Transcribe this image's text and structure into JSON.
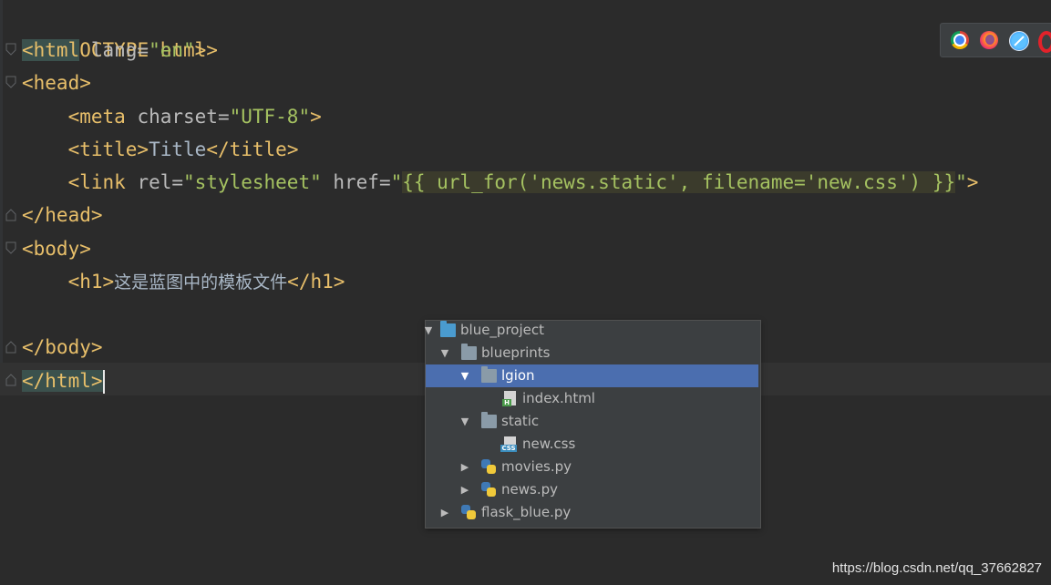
{
  "editor": {
    "lines": [
      {
        "open": "<!DOCTYPE html>"
      },
      {
        "tag_open": "<html",
        "attr": " lang=",
        "val": "\"en\"",
        "close": ">"
      },
      {
        "tag": "<head>"
      },
      {
        "indent": "    ",
        "tag_open": "<meta",
        "attr": " charset=",
        "val": "\"UTF-8\"",
        "close": ">"
      },
      {
        "indent": "    ",
        "tag_open": "<title>",
        "text": "Title",
        "close": "</title>"
      },
      {
        "indent": "    ",
        "tag_open": "<link",
        "attr1": " rel=",
        "val1": "\"stylesheet\"",
        "attr2": " href=",
        "q_open": "\"",
        "tpl": "{{ url_for('news.static', filename='new.css') }}",
        "q_close": "\"",
        "close": ">"
      },
      {
        "tag": "</head>"
      },
      {
        "tag": "<body>"
      },
      {
        "indent": "    ",
        "tag_open": "<h1>",
        "text": "这是蓝图中的模板文件",
        "close": "</h1>"
      },
      {
        "tag": ""
      },
      {
        "tag": "</body>"
      },
      {
        "tag": "</html>"
      }
    ]
  },
  "browser_icons": [
    "chrome-icon",
    "firefox-icon",
    "safari-icon",
    "opera-icon"
  ],
  "project_tree": {
    "items": [
      {
        "label": "blue_project",
        "type": "folder",
        "depth": 0,
        "expanded": true
      },
      {
        "label": "blueprints",
        "type": "folder",
        "depth": 1,
        "expanded": true
      },
      {
        "label": "lgion",
        "type": "folder",
        "depth": 2,
        "expanded": true,
        "selected": true
      },
      {
        "label": "index.html",
        "type": "html",
        "depth": 3
      },
      {
        "label": "static",
        "type": "folder",
        "depth": 2,
        "expanded": true
      },
      {
        "label": "new.css",
        "type": "css",
        "depth": 3
      },
      {
        "label": "movies.py",
        "type": "py",
        "depth": 2,
        "expanded": false
      },
      {
        "label": "news.py",
        "type": "py",
        "depth": 2,
        "expanded": false
      },
      {
        "label": "flask_blue.py",
        "type": "py",
        "depth": 1,
        "expanded": false
      }
    ]
  },
  "watermark": "https://blog.csdn.net/qq_37662827",
  "colors": {
    "background": "#2b2b2b",
    "tag": "#e8bf6a",
    "attribute_value": "#a5c261",
    "selection": "#4b6eaf"
  }
}
